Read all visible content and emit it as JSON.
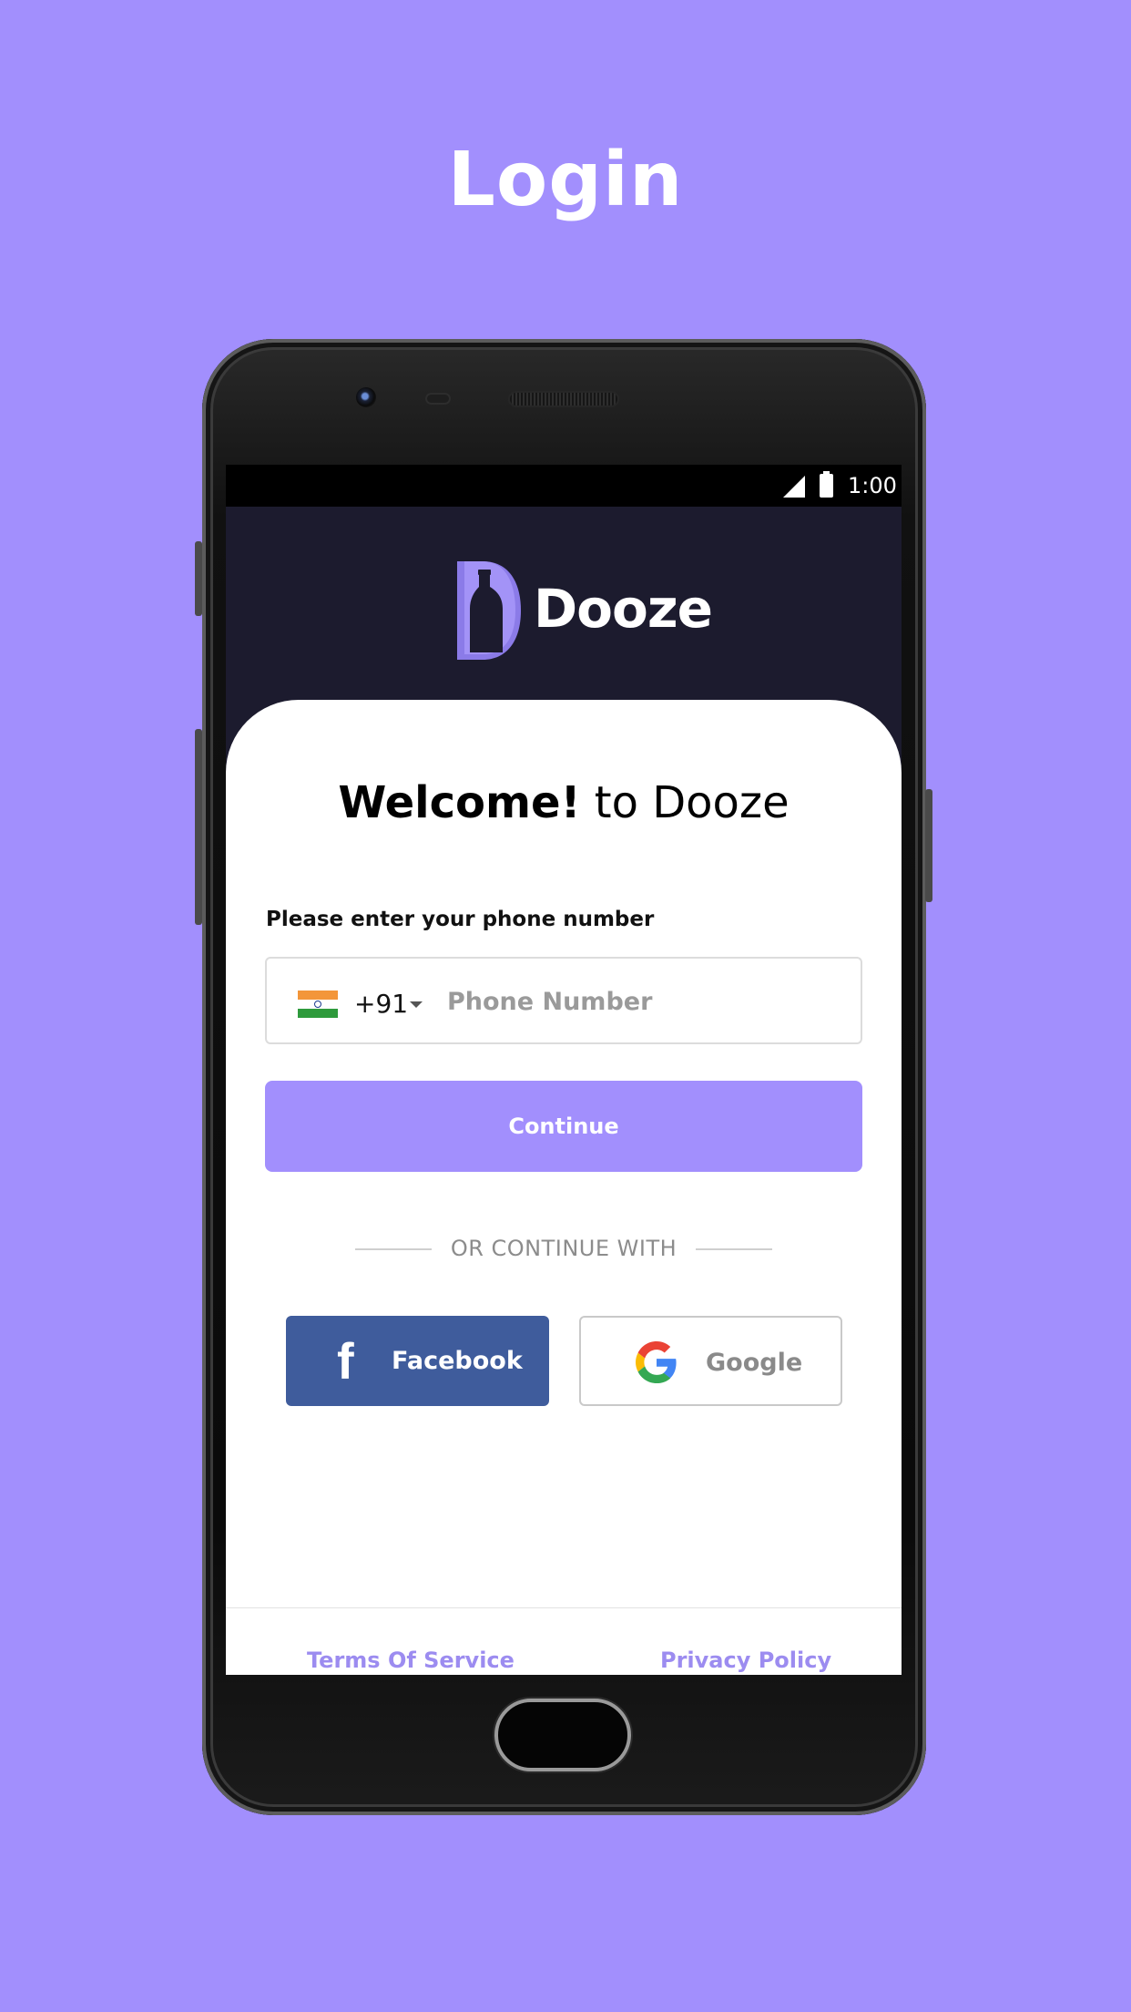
{
  "page_title": "Login",
  "status_bar": {
    "time": "1:00"
  },
  "brand": {
    "name": "Dooze"
  },
  "welcome": {
    "bold": "Welcome!",
    "rest": " to Dooze"
  },
  "phone_section": {
    "label": "Please enter your phone number",
    "country_code": "+91",
    "placeholder": "Phone Number",
    "value": ""
  },
  "continue_label": "Continue",
  "divider_text": "OR CONTINUE WITH",
  "social": {
    "facebook_label": "Facebook",
    "google_label": "Google"
  },
  "footer": {
    "terms_label": "Terms Of Service",
    "privacy_label": "Privacy Policy"
  },
  "colors": {
    "background": "#a28ffd",
    "accent": "#a28ffd",
    "facebook": "#3f5c9c",
    "screen_dark": "#1c1b2e",
    "link": "#9c8cf0"
  },
  "icons": [
    "signal-icon",
    "battery-icon",
    "dooze-logo-icon",
    "india-flag-icon",
    "chevron-down-icon",
    "facebook-icon",
    "google-icon"
  ]
}
